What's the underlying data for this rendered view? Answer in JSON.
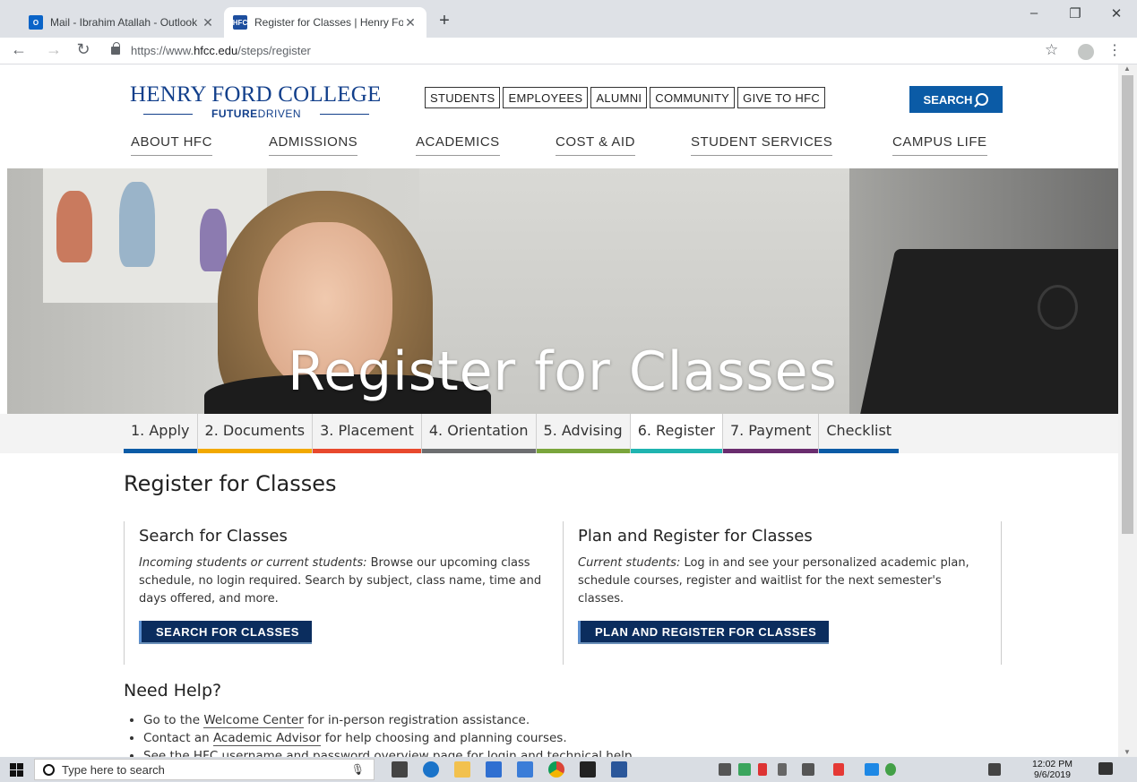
{
  "browser": {
    "tabs": [
      {
        "label": "Mail - Ibrahim Atallah - Outlook",
        "favicon": "O"
      },
      {
        "label": "Register for Classes | Henry Ford",
        "favicon": "HFC"
      }
    ],
    "new_tab": "+",
    "url_prefix": "https://www.",
    "url_domain": "hfcc.edu",
    "url_path": "/steps/register",
    "window_controls": [
      "–",
      "❐",
      "✕"
    ]
  },
  "site": {
    "logo_title": "HENRY FORD COLLEGE",
    "logo_tag_bold": "FUTURE",
    "logo_tag_rest": "DRIVEN",
    "audience_links": [
      "STUDENTS",
      "EMPLOYEES",
      "ALUMNI",
      "COMMUNITY",
      "GIVE TO HFC"
    ],
    "search_label": "SEARCH",
    "main_nav": [
      "ABOUT HFC",
      "ADMISSIONS",
      "ACADEMICS",
      "COST & AID",
      "STUDENT SERVICES",
      "CAMPUS LIFE"
    ],
    "brand_color": "#0b5ba6"
  },
  "hero": {
    "title": "Register for Classes"
  },
  "steps": [
    {
      "label": "1. Apply",
      "color": "#0b5ba6"
    },
    {
      "label": "2. Documents",
      "color": "#f2a900"
    },
    {
      "label": "3. Placement",
      "color": "#e8492d"
    },
    {
      "label": "4. Orientation",
      "color": "#6d6e70"
    },
    {
      "label": "5. Advising",
      "color": "#7aa53c"
    },
    {
      "label": "6. Register",
      "color": "#1fb4b0",
      "active": true
    },
    {
      "label": "7. Payment",
      "color": "#6a2c6e"
    },
    {
      "label": "Checklist",
      "color": "#0b5ba6"
    }
  ],
  "content": {
    "heading": "Register for Classes",
    "search_col": {
      "title": "Search for Classes",
      "lead": "Incoming students or current students:",
      "body": " Browse our upcoming class schedule, no login required. Search by subject, class name, time and days offered, and more.",
      "button": "SEARCH FOR CLASSES"
    },
    "plan_col": {
      "title": "Plan and Register for Classes",
      "lead": "Current students:",
      "body": " Log in and see your personalized academic plan, schedule courses, register and waitlist for the next semester's classes.",
      "button": "PLAN AND REGISTER FOR CLASSES"
    },
    "help": {
      "heading": "Need Help?",
      "items": [
        {
          "pre": "Go to the ",
          "link": "Welcome Center",
          "post": " for in-person registration assistance."
        },
        {
          "pre": "Contact an ",
          "link": "Academic Advisor",
          "post": " for help choosing and planning courses."
        },
        {
          "pre": "See the ",
          "link": "HFC username and password overview page",
          "post": " for login and technical help."
        }
      ]
    }
  },
  "taskbar": {
    "search_placeholder": "Type here to search",
    "time": "12:02 PM",
    "date": "9/6/2019"
  }
}
